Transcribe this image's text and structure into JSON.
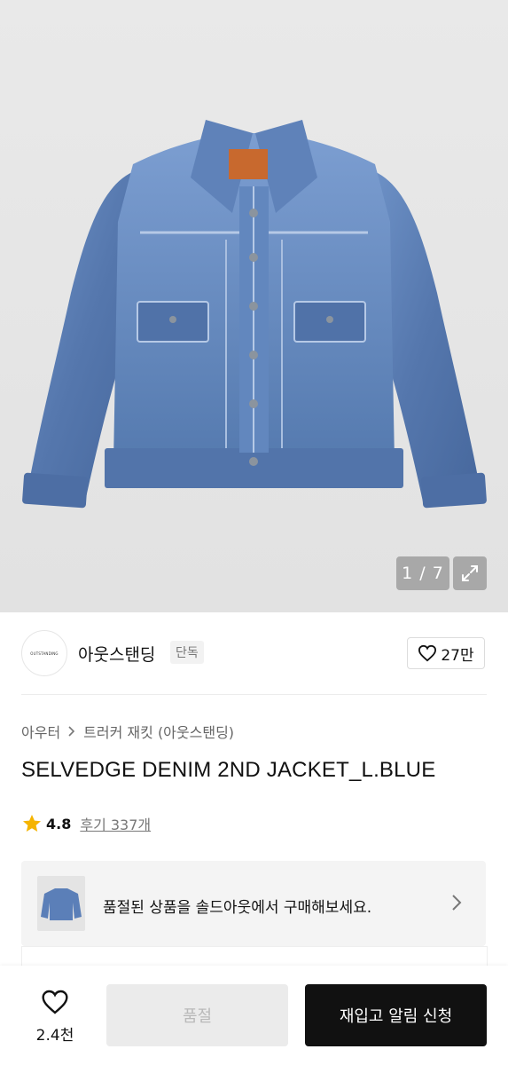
{
  "gallery": {
    "counter": "1 / 7",
    "expand_icon": "expand-icon"
  },
  "brand": {
    "logo_text": "OUTSTANDING",
    "name": "아웃스탠딩",
    "tag": "단독",
    "like_icon": "heart-outline-icon",
    "like_count": "27만"
  },
  "breadcrumb": {
    "category": "아우터",
    "separator_icon": "chevron-right-icon",
    "subcategory": "트러커 재킷 (아웃스탠딩)"
  },
  "product": {
    "title": "SELVEDGE DENIM 2ND JACKET_L.BLUE",
    "rating_icon": "star-icon",
    "rating": "4.8",
    "reviews": "후기 337개"
  },
  "promo": {
    "text": "품절된 상품을 솔드아웃에서 구매해보세요.",
    "chevron_icon": "chevron-right-icon"
  },
  "bottom_bar": {
    "wish_icon": "heart-outline-icon",
    "wish_count": "2.4천",
    "soldout_label": "품절",
    "restock_label": "재입고 알림 신청"
  },
  "colors": {
    "denim": "#5b7fb8",
    "star": "#f5b400",
    "primary_button": "#111111"
  }
}
